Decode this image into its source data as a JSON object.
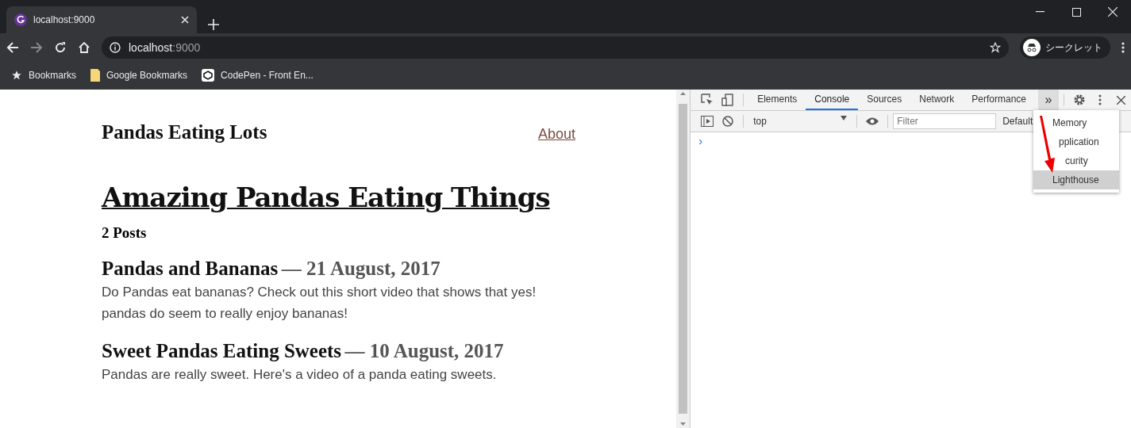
{
  "browser": {
    "tab": {
      "title": "localhost:9000"
    },
    "address": {
      "host": "localhost",
      "port": ":9000"
    },
    "profile": "シークレット",
    "bookmarks": [
      {
        "kind": "star",
        "label": "Bookmarks"
      },
      {
        "kind": "folder",
        "label": "Google Bookmarks"
      },
      {
        "kind": "site",
        "label": "CodePen - Front En..."
      }
    ]
  },
  "page": {
    "site_title": "Pandas Eating Lots",
    "nav_link": "About",
    "heading": "Amazing Pandas Eating Things",
    "post_count": "2 Posts",
    "posts": [
      {
        "title": "Pandas and Bananas",
        "date": "— 21 August, 2017",
        "excerpt": "Do Pandas eat bananas? Check out this short video that shows that yes! pandas do seem to really enjoy bananas!"
      },
      {
        "title": "Sweet Pandas Eating Sweets",
        "date": "— 10 August, 2017",
        "excerpt": "Pandas are really sweet. Here's a video of a panda eating sweets."
      }
    ]
  },
  "devtools": {
    "tabs": [
      {
        "label": "Elements",
        "selected": false
      },
      {
        "label": "Console",
        "selected": true
      },
      {
        "label": "Sources",
        "selected": false
      },
      {
        "label": "Network",
        "selected": false
      },
      {
        "label": "Performance",
        "selected": false
      }
    ],
    "more_tabs": "»",
    "context": "top",
    "filter": {
      "placeholder": "Filter"
    },
    "levels": "Default",
    "prompt": "›",
    "overflow_menu": [
      {
        "label": "Memory",
        "selected": false
      },
      {
        "label": "pplication",
        "selected": false
      },
      {
        "label": "curity",
        "selected": false
      },
      {
        "label": "Lighthouse",
        "selected": true
      }
    ]
  }
}
